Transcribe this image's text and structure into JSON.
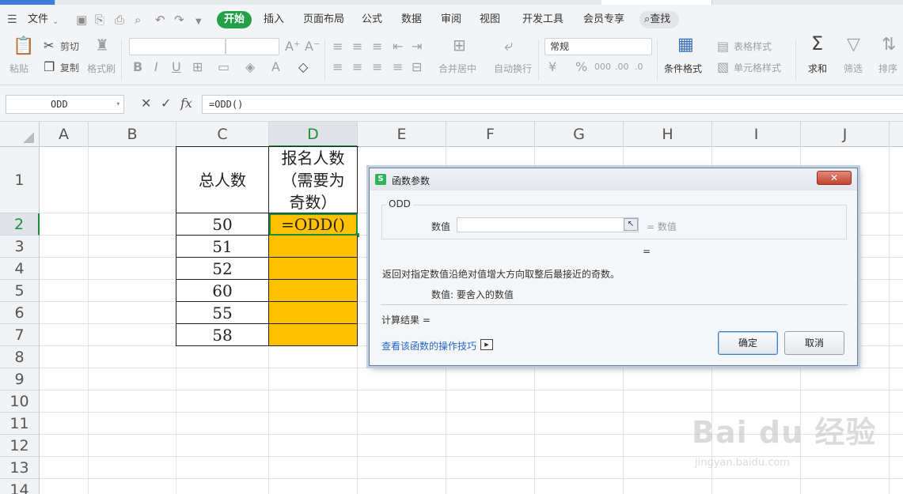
{
  "menubar": {
    "file_label": "文件",
    "tabs": [
      "开始",
      "插入",
      "页面布局",
      "公式",
      "数据",
      "审阅",
      "视图",
      "开发工具",
      "会员专享"
    ],
    "search_label": "查找"
  },
  "ribbon": {
    "paste_label": "粘贴",
    "cut_label": "剪切",
    "copy_label": "复制",
    "format_painter_label": "格式刷",
    "merge_label": "合并居中",
    "wrap_label": "自动换行",
    "number_format": "常规",
    "conditional_format_label": "条件格式",
    "table_style_label": "表格样式",
    "cell_style_label": "单元格样式",
    "sum_label": "求和",
    "filter_label": "筛选",
    "sort_label": "排序"
  },
  "formulabar": {
    "name_box": "ODD",
    "cancel_glyph": "✕",
    "confirm_glyph": "✓",
    "fx_label": "fx",
    "formula": "=ODD()"
  },
  "sheet": {
    "columns": [
      "A",
      "B",
      "C",
      "D",
      "E",
      "F",
      "G",
      "H",
      "I",
      "J"
    ],
    "selected_column": "D",
    "rows": [
      "1",
      "2",
      "3",
      "4",
      "5",
      "6",
      "7",
      "8",
      "9",
      "10",
      "11",
      "12",
      "13",
      "14"
    ],
    "selected_row": "2",
    "header_c1": "总人数",
    "header_d1_lines": [
      "报名人数",
      "（需要为",
      "奇数）"
    ],
    "c_values": [
      "50",
      "51",
      "52",
      "60",
      "55",
      "58"
    ],
    "active_cell_text": "=ODD()",
    "fill_color": "#ffc000"
  },
  "dialog": {
    "title": "函数参数",
    "icon_letter": "S",
    "close_glyph": "✕",
    "function_name": "ODD",
    "arg_label": "数值",
    "arg_eq": "= 数值",
    "result_eq": "=",
    "description": "返回对指定数值沿绝对值增大方向取整后最接近的奇数。",
    "arg_help": "数值:  要舍入的数值",
    "result_label": "计算结果 =",
    "link_text": "查看该函数的操作技巧",
    "ok_label": "确定",
    "cancel_label": "取消"
  },
  "watermark": {
    "brand": "Bai du 经验",
    "url": "jingyan.baidu.com"
  }
}
